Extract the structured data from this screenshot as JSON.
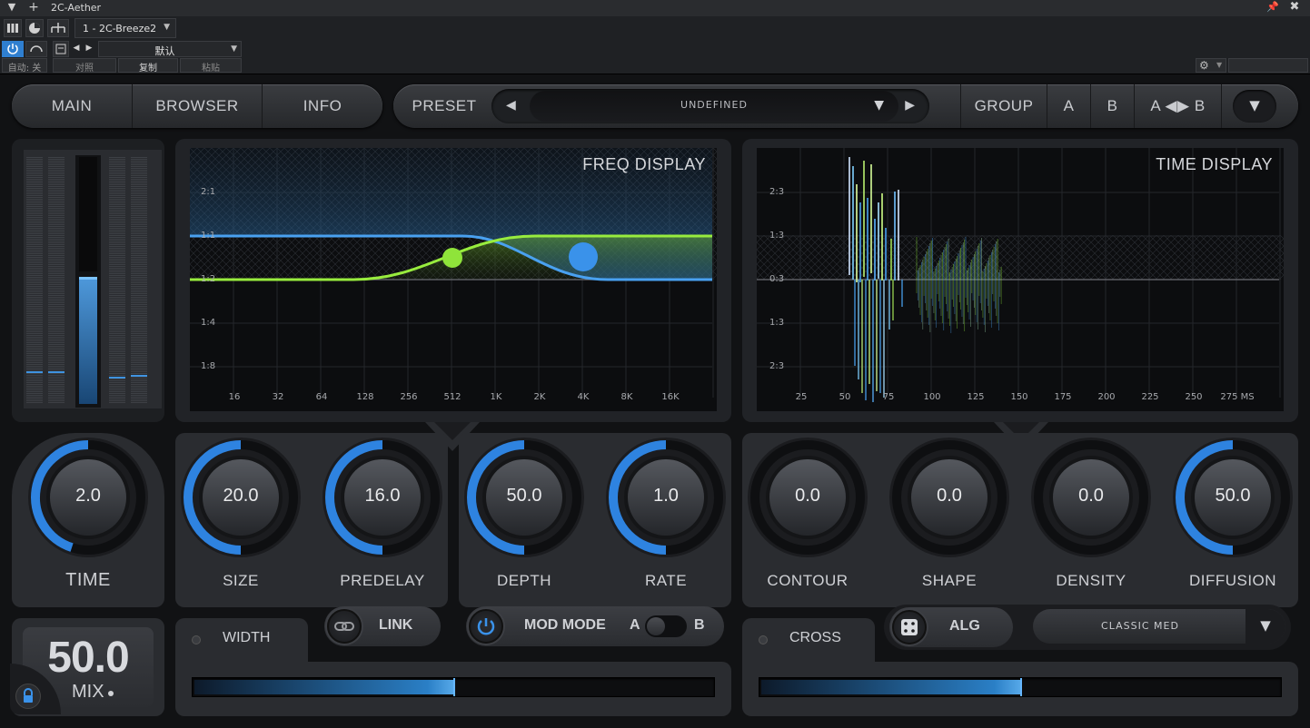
{
  "host": {
    "window_title": "2C-Aether",
    "preset_slot": "1 - 2C-Breeze2",
    "preset_name": "默认",
    "auto_label": "自动: 关",
    "compare_label": "对照",
    "copy_label": "复制",
    "paste_label": "粘贴",
    "icons": [
      "chevron-down-icon",
      "plus-icon",
      "pin-icon",
      "close-icon",
      "power-icon",
      "link-icon",
      "folder-icon",
      "gear-icon"
    ]
  },
  "nav": {
    "main": "MAIN",
    "browser": "BROWSER",
    "info": "INFO",
    "preset_label": "PRESET",
    "preset_value": "UNDEFINED",
    "group": "GROUP",
    "a": "A",
    "b": "B",
    "ab": "A ◀▶ B"
  },
  "freq_display": {
    "title": "FREQ DISPLAY",
    "y_labels": [
      "2:1",
      "1:1",
      "1:2",
      "1:4",
      "1:8"
    ],
    "x_labels": [
      "16",
      "32",
      "64",
      "128",
      "256",
      "512",
      "1K",
      "2K",
      "4K",
      "8K",
      "16K"
    ]
  },
  "time_display": {
    "title": "TIME DISPLAY",
    "y_labels": [
      "2:3",
      "1:3",
      "0:3",
      "1:3",
      "2:3"
    ],
    "x_labels": [
      "25",
      "50",
      "75",
      "100",
      "125",
      "150",
      "175",
      "200",
      "225",
      "250",
      "275 MS"
    ]
  },
  "knobs": {
    "time": {
      "value": "2.0",
      "label": "TIME",
      "fraction": 0.45
    },
    "size": {
      "value": "20.0",
      "label": "SIZE",
      "fraction": 0.5
    },
    "predelay": {
      "value": "16.0",
      "label": "PREDELAY",
      "fraction": 0.5
    },
    "depth": {
      "value": "50.0",
      "label": "DEPTH",
      "fraction": 0.5
    },
    "rate": {
      "value": "1.0",
      "label": "RATE",
      "fraction": 0.5
    },
    "contour": {
      "value": "0.0",
      "label": "CONTOUR",
      "fraction": 0
    },
    "shape": {
      "value": "0.0",
      "label": "SHAPE",
      "fraction": 0
    },
    "density": {
      "value": "0.0",
      "label": "DENSITY",
      "fraction": 0
    },
    "diffusion": {
      "value": "50.0",
      "label": "DIFFUSION",
      "fraction": 0.5
    }
  },
  "mix": {
    "value": "50.0",
    "label": "MIX"
  },
  "width": {
    "label": "WIDTH",
    "fraction": 0.5
  },
  "cross": {
    "label": "CROSS",
    "fraction": 0.5
  },
  "link": {
    "label": "LINK"
  },
  "mod": {
    "label": "MOD MODE",
    "a": "A",
    "b": "B"
  },
  "alg": {
    "label": "ALG",
    "value": "CLASSIC MED"
  },
  "colors": {
    "accent_blue": "#3a92ea",
    "accent_green": "#8fe43a",
    "panel": "#2a2c30"
  }
}
